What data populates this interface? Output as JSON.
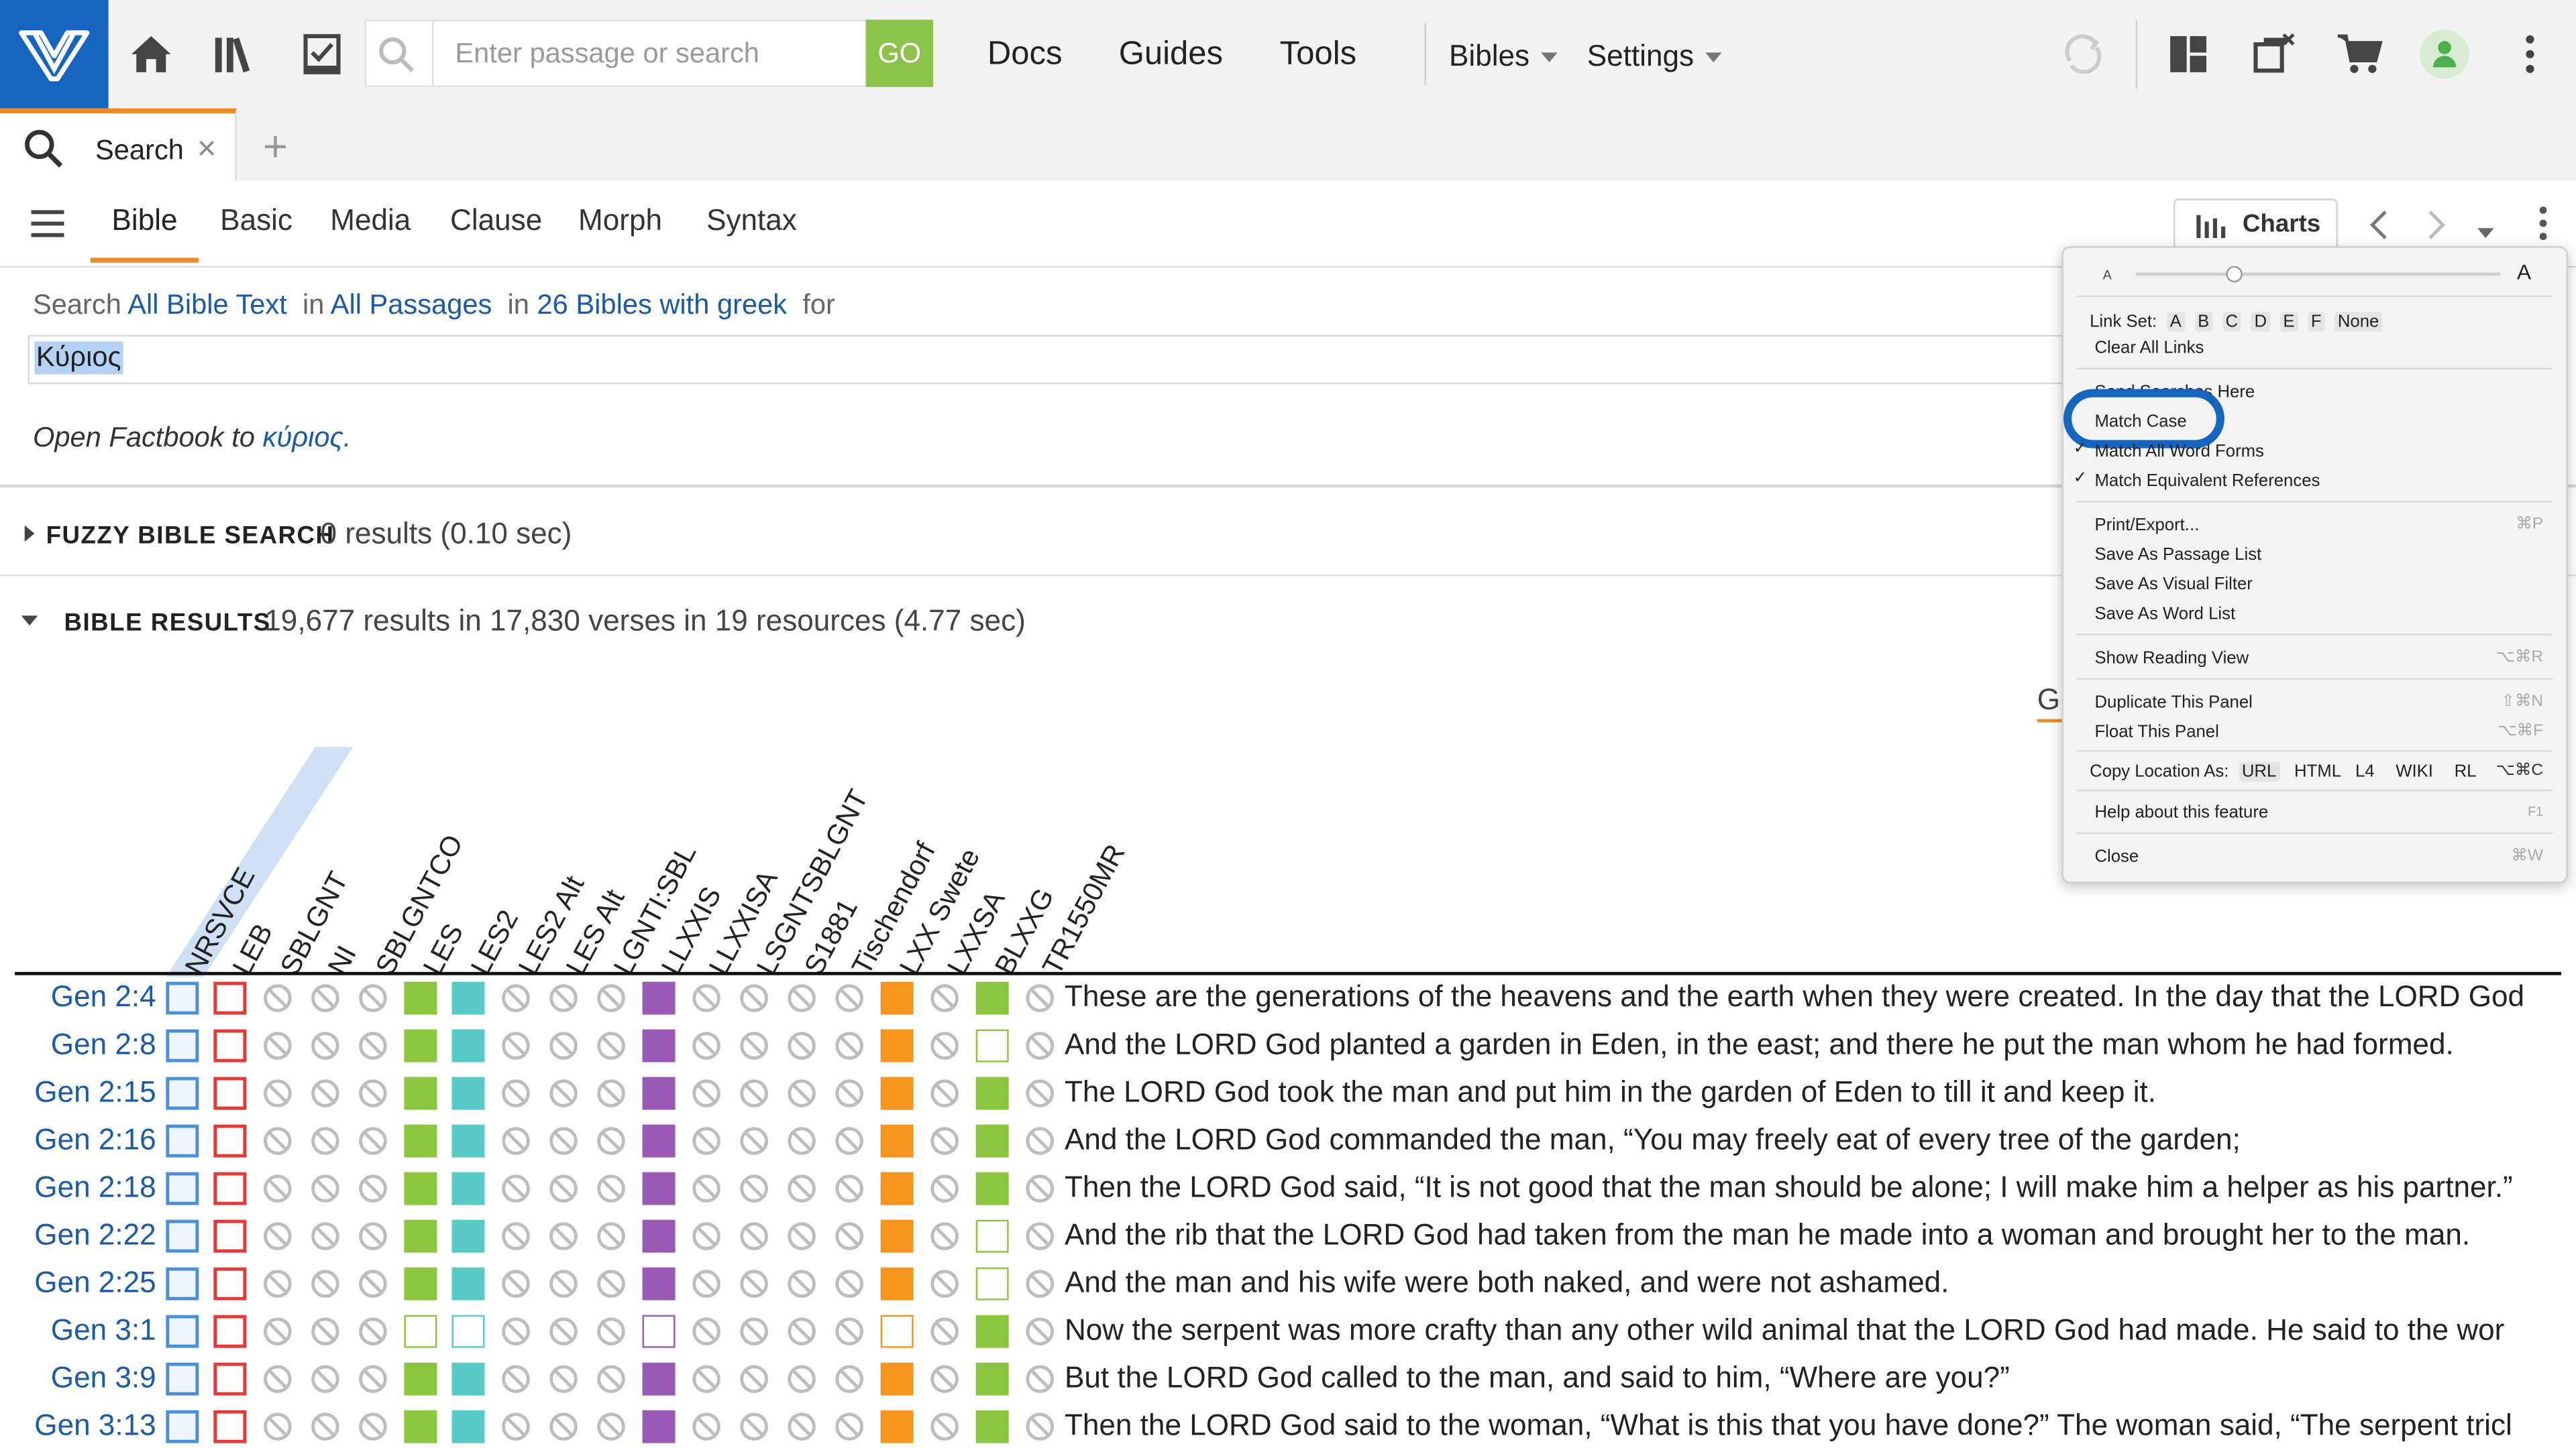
{
  "topbar": {
    "search_placeholder": "Enter passage or search",
    "go_label": "GO",
    "nav": [
      "Docs",
      "Guides",
      "Tools"
    ],
    "dropdowns": [
      "Bibles",
      "Settings"
    ],
    "accent_color": "#1565c0",
    "go_color": "#8bc34a"
  },
  "tabs": {
    "search_label": "Search",
    "close_glyph": "×",
    "add_glyph": "+"
  },
  "subtabs": [
    "Bible",
    "Basic",
    "Media",
    "Clause",
    "Morph",
    "Syntax"
  ],
  "toolbar": {
    "charts_label": "Charts"
  },
  "query": {
    "search_word": "Search",
    "scope": "All Bible Text",
    "in1": "in",
    "range": "All Passages",
    "in2": "in",
    "bibles": "26 Bibles with greek",
    "for_word": "for",
    "term": "Κύριος",
    "factbook_prefix": "Open Factbook to",
    "factbook_term": "κύριος."
  },
  "fuzzy": {
    "title": "FUZZY BIBLE SEARCH",
    "info": "0 results (0.10 sec)"
  },
  "results": {
    "title": "BIBLE RESULTS",
    "info": "19,677 results in 17,830 verses in 19 resources (4.77 sec)",
    "partial_label": "Gr",
    "columns": [
      "NRSVCE",
      "LEB",
      "SBLGNT",
      "NI",
      "SBLGNTCO",
      "LES",
      "LES2",
      "LES2 Alt",
      "LES Alt",
      "LGNTI:SBL",
      "LLXXIS",
      "LLXXISA",
      "LSGNTSBLGNT",
      "S1881",
      "Tischendorf",
      "LXX Swete",
      "LXXSA",
      "BLXXG",
      "TR1550MR"
    ],
    "rows": [
      {
        "ref": "Gen 2:4",
        "text": "These are the generations of the heavens and the earth when they were created. In the day that the LORD God",
        "hollow": []
      },
      {
        "ref": "Gen 2:8",
        "text": "And the LORD God planted a garden in Eden, in the east; and there he put the man whom he had formed.",
        "hollow": [
          17
        ]
      },
      {
        "ref": "Gen 2:15",
        "text": "The LORD God took the man and put him in the garden of Eden to till it and keep it.",
        "hollow": []
      },
      {
        "ref": "Gen 2:16",
        "text": "And the LORD God commanded the man, “You may freely eat of every tree of the garden;",
        "hollow": []
      },
      {
        "ref": "Gen 2:18",
        "text": "Then the LORD God said, “It is not good that the man should be alone; I will make him a helper as his partner.”",
        "hollow": []
      },
      {
        "ref": "Gen 2:22",
        "text": "And the rib that the LORD God had taken from the man he made into a woman and brought her to the man.",
        "hollow": [
          17
        ]
      },
      {
        "ref": "Gen 2:25",
        "text": "And the man and his wife were both naked, and were not ashamed.",
        "hollow": [
          17
        ]
      },
      {
        "ref": "Gen 3:1",
        "text": "Now the serpent was more crafty than any other wild animal that the LORD God had made. He said to the wor",
        "hollow": [
          5,
          6,
          10,
          15
        ]
      },
      {
        "ref": "Gen 3:9",
        "text": "But the LORD God called to the man, and said to him, “Where are you?”",
        "hollow": []
      },
      {
        "ref": "Gen 3:13",
        "text": "Then the LORD God said to the woman, “What is this that you have done?” The woman said, “The serpent tricl",
        "hollow": []
      }
    ]
  },
  "menu": {
    "font_small": "A",
    "font_large": "A",
    "link_set_label": "Link Set:",
    "link_set_options": [
      "A",
      "B",
      "C",
      "D",
      "E",
      "F",
      "None"
    ],
    "clear_links": "Clear All Links",
    "send_searches": "Send Searches Here",
    "match_case": "Match Case",
    "match_word_forms": "Match All Word Forms",
    "match_equiv": "Match Equivalent References",
    "check": "✓",
    "print_export": "Print/Export...",
    "print_sc": "⌘P",
    "save_passage": "Save As Passage List",
    "save_filter": "Save As Visual Filter",
    "save_word": "Save As Word List",
    "reading_view": "Show Reading View",
    "reading_sc": "⌥⌘R",
    "duplicate": "Duplicate This Panel",
    "duplicate_sc": "⇧⌘N",
    "float": "Float This Panel",
    "float_sc": "⌥⌘F",
    "copy_location": "Copy Location As:",
    "copy_formats": [
      "URL",
      "HTML",
      "L4",
      "WIKI",
      "RL"
    ],
    "copy_sc": "⌥⌘C",
    "help": "Help about this feature",
    "help_sc": "F1",
    "close": "Close",
    "close_sc": "⌘W",
    "highlight_color": "#1565c0"
  }
}
